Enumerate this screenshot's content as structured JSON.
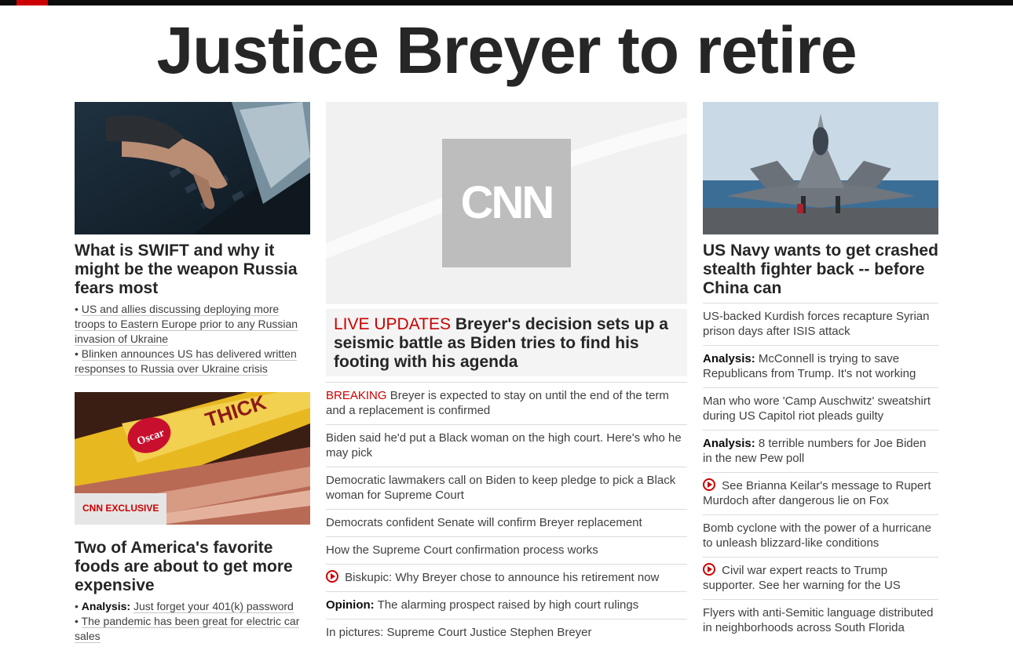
{
  "headline": "Justice Breyer to retire",
  "left": {
    "card1": {
      "title": "What is SWIFT and why it might be the weapon Russia fears most",
      "bullets": [
        "US and allies discussing deploying more troops to Eastern Europe prior to any Russian invasion of Ukraine",
        "Blinken announces US has delivered written responses to Russia over Ukraine crisis"
      ]
    },
    "card2": {
      "badge": "CNN EXCLUSIVE",
      "title": "Two of America's favorite foods are about to get more expensive",
      "bullet1_prefix": "Analysis:",
      "bullet1_text": "Just forget your 401(k) password",
      "bullet2": "The pandemic has been great for electric car sales"
    }
  },
  "middle": {
    "logo_text": "CNN",
    "live_tag": "LIVE UPDATES",
    "headline": "Breyer's decision sets up a seismic battle as Biden tries to find his footing with his agenda",
    "items": [
      {
        "tag": "BREAKING",
        "text": "Breyer is expected to stay on until the end of the term and a replacement is confirmed"
      },
      {
        "text": "Biden said he'd put a Black woman on the high court. Here's who he may pick"
      },
      {
        "text": "Democratic lawmakers call on Biden to keep pledge to pick a Black woman for Supreme Court"
      },
      {
        "text": "Democrats confident Senate will confirm Breyer replacement"
      },
      {
        "text": "How the Supreme Court confirmation process works"
      },
      {
        "video": true,
        "text": "Biskupic: Why Breyer chose to announce his retirement now"
      },
      {
        "prefix": "Opinion:",
        "text": "The alarming prospect raised by high court rulings"
      },
      {
        "text": "In pictures: Supreme Court Justice Stephen Breyer"
      }
    ]
  },
  "right": {
    "title": "US Navy wants to get crashed stealth fighter back -- before China can",
    "items": [
      {
        "text": "US-backed Kurdish forces recapture Syrian prison days after ISIS attack"
      },
      {
        "prefix": "Analysis:",
        "text": "McConnell is trying to save Republicans from Trump. It's not working"
      },
      {
        "text": "Man who wore 'Camp Auschwitz' sweatshirt during US Capitol riot pleads guilty"
      },
      {
        "prefix": "Analysis:",
        "text": "8 terrible numbers for Joe Biden in the new Pew poll"
      },
      {
        "video": true,
        "text": "See Brianna Keilar's message to Rupert Murdoch after dangerous lie on Fox"
      },
      {
        "text": "Bomb cyclone with the power of a hurricane to unleash blizzard-like conditions"
      },
      {
        "video": true,
        "text": "Civil war expert reacts to Trump supporter. See her warning for the US"
      },
      {
        "text": "Flyers with anti-Semitic language distributed in neighborhoods across South Florida"
      }
    ]
  },
  "colors": {
    "accent": "#cc0000",
    "text": "#262626",
    "topbar": "#0c0c0c"
  }
}
